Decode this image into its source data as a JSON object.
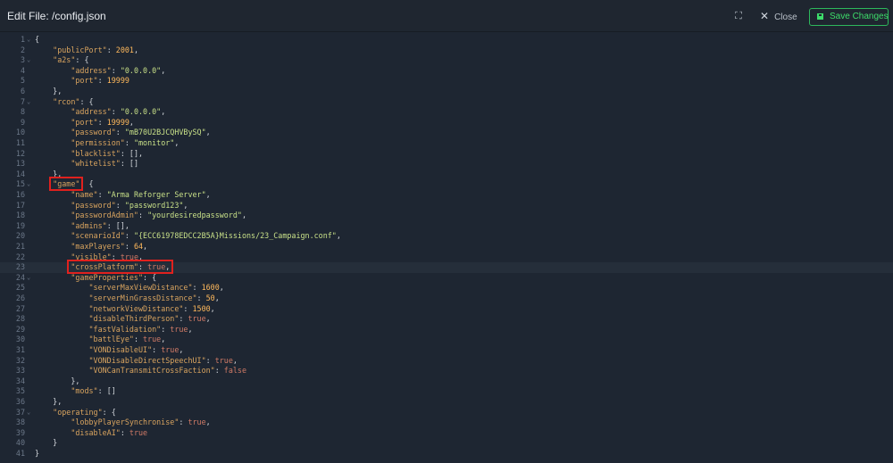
{
  "header": {
    "title": "Edit File:  /config.json",
    "expand_icon": "⛶",
    "close_label": "Close",
    "save_label": "Save Changes",
    "accent": "#3ddc6a"
  },
  "editor": {
    "lines": [
      {
        "n": "1",
        "fold": true,
        "indent": 0,
        "parts": [
          [
            "p",
            "{"
          ]
        ]
      },
      {
        "n": "2",
        "indent": 1,
        "parts": [
          [
            "k",
            "\"publicPort\""
          ],
          [
            "p",
            ": "
          ],
          [
            "n",
            "2001"
          ],
          [
            "p",
            ","
          ]
        ]
      },
      {
        "n": "3",
        "fold": true,
        "indent": 1,
        "parts": [
          [
            "k",
            "\"a2s\""
          ],
          [
            "p",
            ": {"
          ]
        ]
      },
      {
        "n": "4",
        "indent": 2,
        "parts": [
          [
            "k",
            "\"address\""
          ],
          [
            "p",
            ": "
          ],
          [
            "s",
            "\"0.0.0.0\""
          ],
          [
            "p",
            ","
          ]
        ]
      },
      {
        "n": "5",
        "indent": 2,
        "parts": [
          [
            "k",
            "\"port\""
          ],
          [
            "p",
            ": "
          ],
          [
            "n",
            "19999"
          ]
        ]
      },
      {
        "n": "6",
        "indent": 1,
        "parts": [
          [
            "p",
            "},"
          ]
        ]
      },
      {
        "n": "7",
        "fold": true,
        "indent": 1,
        "parts": [
          [
            "k",
            "\"rcon\""
          ],
          [
            "p",
            ": {"
          ]
        ]
      },
      {
        "n": "8",
        "indent": 2,
        "parts": [
          [
            "k",
            "\"address\""
          ],
          [
            "p",
            ": "
          ],
          [
            "s",
            "\"0.0.0.0\""
          ],
          [
            "p",
            ","
          ]
        ]
      },
      {
        "n": "9",
        "indent": 2,
        "parts": [
          [
            "k",
            "\"port\""
          ],
          [
            "p",
            ": "
          ],
          [
            "n",
            "19999"
          ],
          [
            "p",
            ","
          ]
        ]
      },
      {
        "n": "10",
        "indent": 2,
        "parts": [
          [
            "k",
            "\"password\""
          ],
          [
            "p",
            ": "
          ],
          [
            "s",
            "\"mB70U2BJCQHVBySQ\""
          ],
          [
            "p",
            ","
          ]
        ]
      },
      {
        "n": "11",
        "indent": 2,
        "parts": [
          [
            "k",
            "\"permission\""
          ],
          [
            "p",
            ": "
          ],
          [
            "s",
            "\"monitor\""
          ],
          [
            "p",
            ","
          ]
        ]
      },
      {
        "n": "12",
        "indent": 2,
        "parts": [
          [
            "k",
            "\"blacklist\""
          ],
          [
            "p",
            ": [],"
          ]
        ]
      },
      {
        "n": "13",
        "indent": 2,
        "parts": [
          [
            "k",
            "\"whitelist\""
          ],
          [
            "p",
            ": []"
          ]
        ]
      },
      {
        "n": "14",
        "indent": 1,
        "parts": [
          [
            "p",
            "},"
          ]
        ]
      },
      {
        "n": "15",
        "fold": true,
        "indent": 1,
        "parts": [
          [
            "k",
            "\"game\""
          ],
          [
            "p",
            ": {"
          ]
        ]
      },
      {
        "n": "16",
        "indent": 2,
        "parts": [
          [
            "k",
            "\"name\""
          ],
          [
            "p",
            ": "
          ],
          [
            "s",
            "\"Arma Reforger Server\""
          ],
          [
            "p",
            ","
          ]
        ]
      },
      {
        "n": "17",
        "indent": 2,
        "parts": [
          [
            "k",
            "\"password\""
          ],
          [
            "p",
            ": "
          ],
          [
            "s",
            "\"password123\""
          ],
          [
            "p",
            ","
          ]
        ]
      },
      {
        "n": "18",
        "indent": 2,
        "parts": [
          [
            "k",
            "\"passwordAdmin\""
          ],
          [
            "p",
            ": "
          ],
          [
            "s",
            "\"yourdesiredpassword\""
          ],
          [
            "p",
            ","
          ]
        ]
      },
      {
        "n": "19",
        "indent": 2,
        "parts": [
          [
            "k",
            "\"admins\""
          ],
          [
            "p",
            ": [],"
          ]
        ]
      },
      {
        "n": "20",
        "indent": 2,
        "parts": [
          [
            "k",
            "\"scenarioId\""
          ],
          [
            "p",
            ": "
          ],
          [
            "s",
            "\"{ECC61978EDCC2B5A}Missions/23_Campaign.conf\""
          ],
          [
            "p",
            ","
          ]
        ]
      },
      {
        "n": "21",
        "indent": 2,
        "parts": [
          [
            "k",
            "\"maxPlayers\""
          ],
          [
            "p",
            ": "
          ],
          [
            "n",
            "64"
          ],
          [
            "p",
            ","
          ]
        ]
      },
      {
        "n": "22",
        "indent": 2,
        "parts": [
          [
            "k",
            "\"visible\""
          ],
          [
            "p",
            ": "
          ],
          [
            "b",
            "true"
          ],
          [
            "p",
            ","
          ]
        ]
      },
      {
        "n": "23",
        "indent": 2,
        "active": true,
        "parts": [
          [
            "k",
            "\"crossPlatform\""
          ],
          [
            "p",
            ": "
          ],
          [
            "b",
            "true"
          ],
          [
            "p",
            ","
          ]
        ]
      },
      {
        "n": "24",
        "fold": true,
        "indent": 2,
        "parts": [
          [
            "k",
            "\"gameProperties\""
          ],
          [
            "p",
            ": {"
          ]
        ]
      },
      {
        "n": "25",
        "indent": 3,
        "parts": [
          [
            "k",
            "\"serverMaxViewDistance\""
          ],
          [
            "p",
            ": "
          ],
          [
            "n",
            "1600"
          ],
          [
            "p",
            ","
          ]
        ]
      },
      {
        "n": "26",
        "indent": 3,
        "parts": [
          [
            "k",
            "\"serverMinGrassDistance\""
          ],
          [
            "p",
            ": "
          ],
          [
            "n",
            "50"
          ],
          [
            "p",
            ","
          ]
        ]
      },
      {
        "n": "27",
        "indent": 3,
        "parts": [
          [
            "k",
            "\"networkViewDistance\""
          ],
          [
            "p",
            ": "
          ],
          [
            "n",
            "1500"
          ],
          [
            "p",
            ","
          ]
        ]
      },
      {
        "n": "28",
        "indent": 3,
        "parts": [
          [
            "k",
            "\"disableThirdPerson\""
          ],
          [
            "p",
            ": "
          ],
          [
            "b",
            "true"
          ],
          [
            "p",
            ","
          ]
        ]
      },
      {
        "n": "29",
        "indent": 3,
        "parts": [
          [
            "k",
            "\"fastValidation\""
          ],
          [
            "p",
            ": "
          ],
          [
            "b",
            "true"
          ],
          [
            "p",
            ","
          ]
        ]
      },
      {
        "n": "30",
        "indent": 3,
        "parts": [
          [
            "k",
            "\"battlEye\""
          ],
          [
            "p",
            ": "
          ],
          [
            "b",
            "true"
          ],
          [
            "p",
            ","
          ]
        ]
      },
      {
        "n": "31",
        "indent": 3,
        "parts": [
          [
            "k",
            "\"VONDisableUI\""
          ],
          [
            "p",
            ": "
          ],
          [
            "b",
            "true"
          ],
          [
            "p",
            ","
          ]
        ]
      },
      {
        "n": "32",
        "indent": 3,
        "parts": [
          [
            "k",
            "\"VONDisableDirectSpeechUI\""
          ],
          [
            "p",
            ": "
          ],
          [
            "b",
            "true"
          ],
          [
            "p",
            ","
          ]
        ]
      },
      {
        "n": "33",
        "indent": 3,
        "parts": [
          [
            "k",
            "\"VONCanTransmitCrossFaction\""
          ],
          [
            "p",
            ": "
          ],
          [
            "b",
            "false"
          ]
        ]
      },
      {
        "n": "34",
        "indent": 2,
        "parts": [
          [
            "p",
            "},"
          ]
        ]
      },
      {
        "n": "35",
        "indent": 2,
        "parts": [
          [
            "k",
            "\"mods\""
          ],
          [
            "p",
            ": []"
          ]
        ]
      },
      {
        "n": "36",
        "indent": 1,
        "parts": [
          [
            "p",
            "},"
          ]
        ]
      },
      {
        "n": "37",
        "fold": true,
        "indent": 1,
        "parts": [
          [
            "k",
            "\"operating\""
          ],
          [
            "p",
            ": {"
          ]
        ]
      },
      {
        "n": "38",
        "indent": 2,
        "parts": [
          [
            "k",
            "\"lobbyPlayerSynchronise\""
          ],
          [
            "p",
            ": "
          ],
          [
            "b",
            "true"
          ],
          [
            "p",
            ","
          ]
        ]
      },
      {
        "n": "39",
        "indent": 2,
        "parts": [
          [
            "k",
            "\"disableAI\""
          ],
          [
            "p",
            ": "
          ],
          [
            "b",
            "true"
          ]
        ]
      },
      {
        "n": "40",
        "indent": 1,
        "parts": [
          [
            "p",
            "}"
          ]
        ]
      },
      {
        "n": "41",
        "indent": 0,
        "parts": [
          [
            "p",
            "}"
          ]
        ]
      }
    ]
  }
}
